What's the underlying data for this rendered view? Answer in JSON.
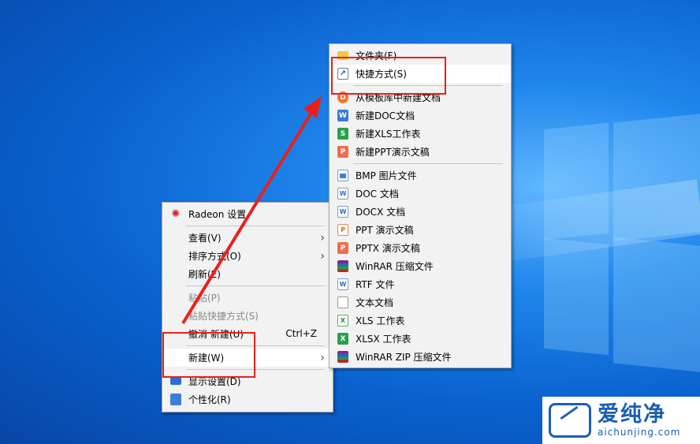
{
  "desktop_menu": {
    "items": [
      {
        "label": "Radeon 设置",
        "icon": "radeon-icon"
      },
      {
        "label": "查看(V)",
        "has_submenu": true
      },
      {
        "label": "排序方式(O)",
        "has_submenu": true
      },
      {
        "label": "刷新(E)"
      },
      {
        "label": "粘贴(P)",
        "disabled": true
      },
      {
        "label": "粘贴快捷方式(S)",
        "disabled": true
      },
      {
        "label": "撤消 新建(U)",
        "shortcut": "Ctrl+Z"
      },
      {
        "label": "新建(W)",
        "has_submenu": true,
        "highlighted": true
      },
      {
        "label": "显示设置(D)",
        "icon": "display-icon"
      },
      {
        "label": "个性化(R)",
        "icon": "personalize-icon"
      }
    ]
  },
  "new_submenu": {
    "items": [
      {
        "label": "文件夹(F)",
        "icon": "folder-icon"
      },
      {
        "label": "快捷方式(S)",
        "icon": "shortcut-icon",
        "highlighted": true
      },
      {
        "label": "从模板库中新建文档",
        "icon": "template-icon"
      },
      {
        "label": "新建DOC文档",
        "icon": "wps-writer-icon"
      },
      {
        "label": "新建XLS工作表",
        "icon": "wps-sheet-icon"
      },
      {
        "label": "新建PPT演示文稿",
        "icon": "wps-presentation-icon"
      },
      {
        "label": "BMP 图片文件",
        "icon": "bmp-icon"
      },
      {
        "label": "DOC 文档",
        "icon": "doc-icon"
      },
      {
        "label": "DOCX 文档",
        "icon": "docx-icon"
      },
      {
        "label": "PPT 演示文稿",
        "icon": "ppt-icon"
      },
      {
        "label": "PPTX 演示文稿",
        "icon": "pptx-icon"
      },
      {
        "label": "WinRAR 压缩文件",
        "icon": "winrar-icon"
      },
      {
        "label": "RTF 文件",
        "icon": "rtf-icon"
      },
      {
        "label": "文本文档",
        "icon": "text-document-icon"
      },
      {
        "label": "XLS 工作表",
        "icon": "xls-icon"
      },
      {
        "label": "XLSX 工作表",
        "icon": "xlsx-icon"
      },
      {
        "label": "WinRAR ZIP 压缩文件",
        "icon": "winrar-zip-icon"
      }
    ]
  },
  "icon_glyphs": {
    "radeon": "✺",
    "template": "D",
    "wps_writer": "W",
    "wps_sheet": "S",
    "wps_presentation": "P",
    "doc": "W",
    "ppt": "P",
    "xls": "X"
  },
  "colors": {
    "annotation_red": "#e8201c",
    "menu_background": "#f2f2f2",
    "watermark_blue": "#1a5fb3"
  },
  "watermark": {
    "brand": "爱纯净",
    "url": "aichunjing.com"
  }
}
